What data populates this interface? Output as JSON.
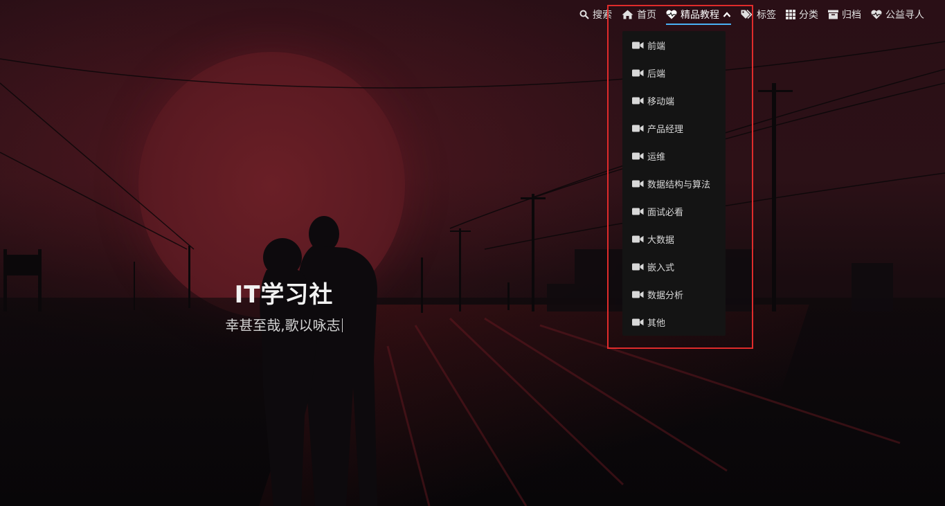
{
  "site": {
    "title": "IT学习社",
    "subtitle": "幸甚至哉,歌以咏志"
  },
  "nav": {
    "items": [
      {
        "label": "搜索",
        "icon": "search-icon"
      },
      {
        "label": "首页",
        "icon": "home-icon"
      },
      {
        "label": "精品教程",
        "icon": "heart-pulse-icon",
        "active": true
      },
      {
        "label": "标签",
        "icon": "tags-icon"
      },
      {
        "label": "分类",
        "icon": "grid-icon"
      },
      {
        "label": "归档",
        "icon": "archive-icon"
      },
      {
        "label": "公益寻人",
        "icon": "heart-pulse-icon"
      }
    ]
  },
  "dropdown": {
    "items": [
      {
        "label": "前端",
        "icon": "video-icon"
      },
      {
        "label": "后端",
        "icon": "video-icon"
      },
      {
        "label": "移动端",
        "icon": "video-icon"
      },
      {
        "label": "产品经理",
        "icon": "video-icon"
      },
      {
        "label": "运维",
        "icon": "video-icon"
      },
      {
        "label": "数据结构与算法",
        "icon": "video-icon"
      },
      {
        "label": "面试必看",
        "icon": "video-icon"
      },
      {
        "label": "大数据",
        "icon": "video-icon"
      },
      {
        "label": "嵌入式",
        "icon": "video-icon"
      },
      {
        "label": "数据分析",
        "icon": "video-icon"
      },
      {
        "label": "其他",
        "icon": "video-icon"
      }
    ]
  },
  "colors": {
    "accent": "#49b1f5",
    "highlight_box": "#e02b2b",
    "dropdown_bg": "#141414"
  }
}
